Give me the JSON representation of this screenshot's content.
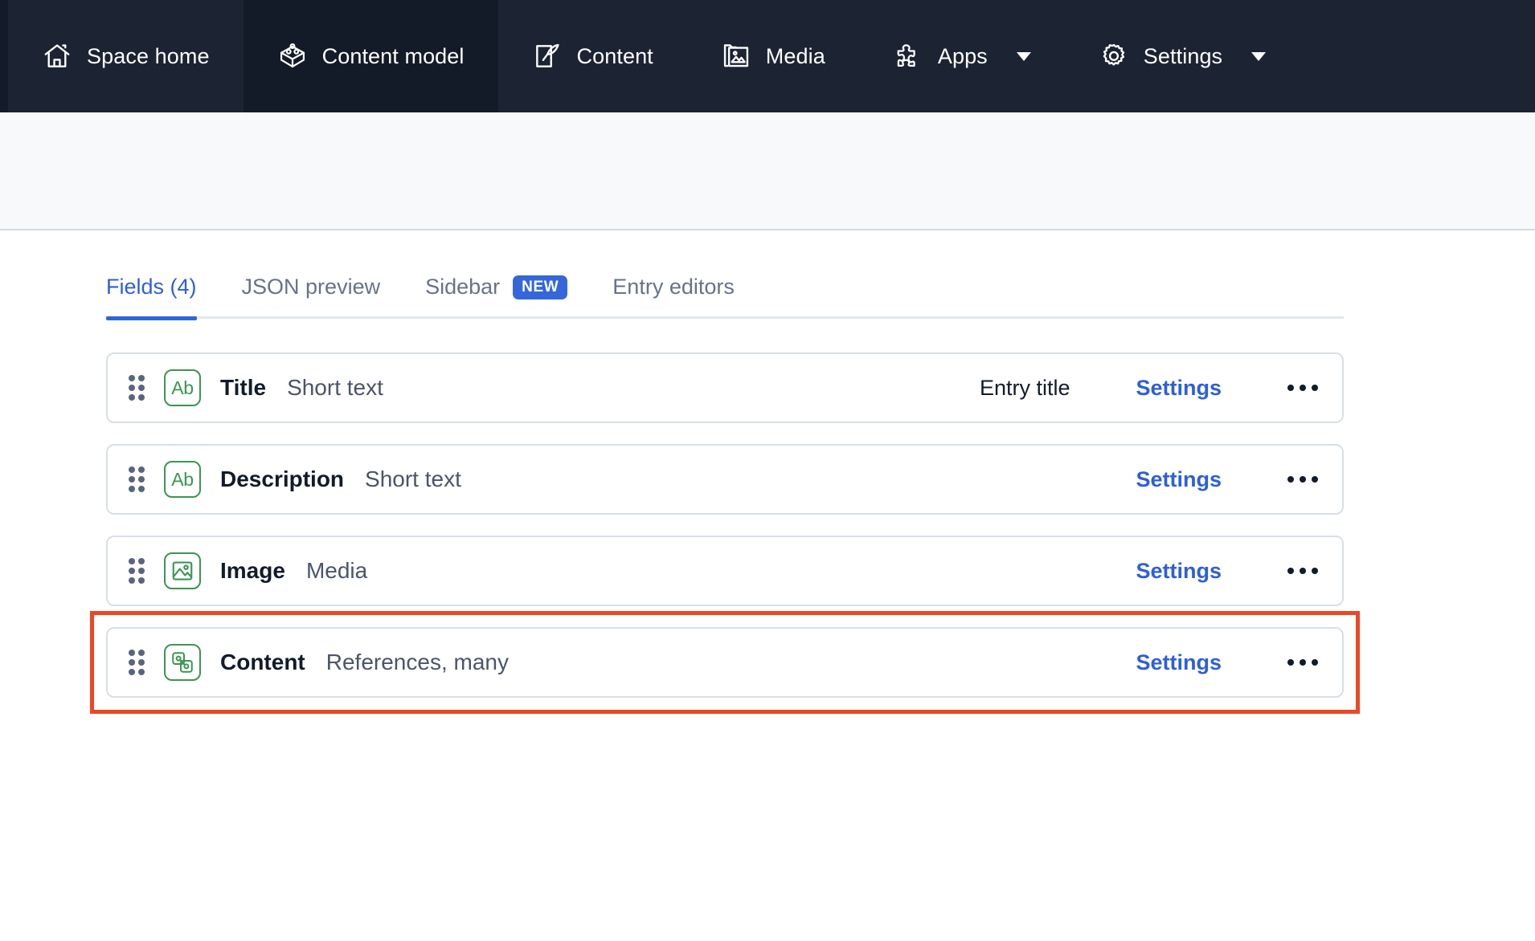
{
  "topnav": {
    "items": [
      {
        "label": "Space home",
        "icon": "home-icon",
        "active": false,
        "caret": false
      },
      {
        "label": "Content model",
        "icon": "content-model-icon",
        "active": true,
        "caret": false
      },
      {
        "label": "Content",
        "icon": "content-icon",
        "active": false,
        "caret": false
      },
      {
        "label": "Media",
        "icon": "media-icon",
        "active": false,
        "caret": false
      },
      {
        "label": "Apps",
        "icon": "apps-puzzle-icon",
        "active": false,
        "caret": true
      },
      {
        "label": "Settings",
        "icon": "gear-icon",
        "active": false,
        "caret": true
      }
    ]
  },
  "tabs": [
    {
      "label": "Fields (4)",
      "active": true,
      "badge": null
    },
    {
      "label": "JSON preview",
      "active": false,
      "badge": null
    },
    {
      "label": "Sidebar",
      "active": false,
      "badge": "NEW"
    },
    {
      "label": "Entry editors",
      "active": false,
      "badge": null
    }
  ],
  "fields": {
    "settings_label": "Settings",
    "rows": [
      {
        "name": "Title",
        "type": "Short text",
        "icon": "short-text-ab-icon",
        "entry_title": "Entry title",
        "highlighted": false
      },
      {
        "name": "Description",
        "type": "Short text",
        "icon": "short-text-ab-icon",
        "entry_title": "",
        "highlighted": false
      },
      {
        "name": "Image",
        "type": "Media",
        "icon": "media-image-icon",
        "entry_title": "",
        "highlighted": false
      },
      {
        "name": "Content",
        "type": "References, many",
        "icon": "references-icon",
        "entry_title": "",
        "highlighted": true
      }
    ]
  },
  "colors": {
    "nav_background": "#1C2433",
    "nav_active_background": "#141B28",
    "accent_blue": "#2E5FD9",
    "badge_blue": "#3567DB",
    "icon_green": "#3C9553",
    "highlight_red": "#EE4624",
    "subheader_background": "#F7F9FA"
  }
}
